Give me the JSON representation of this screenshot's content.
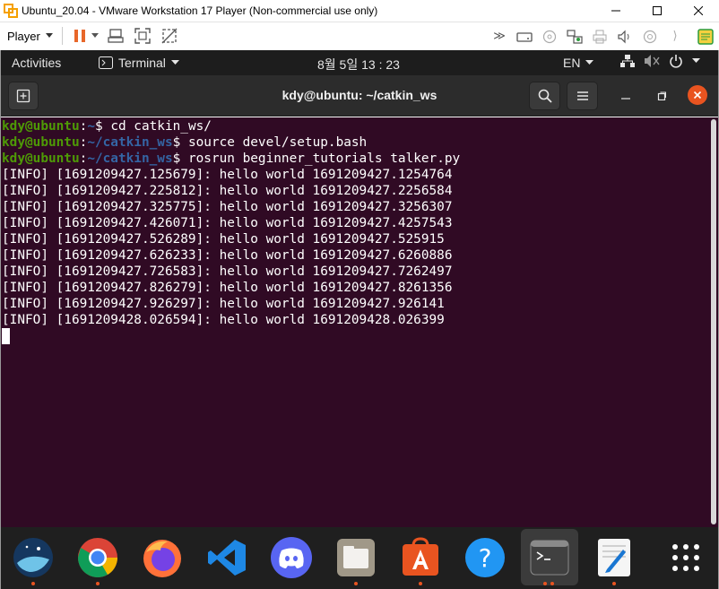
{
  "vmware": {
    "title": "Ubuntu_20.04 - VMware Workstation 17 Player (Non-commercial use only)",
    "player_label": "Player",
    "controls": {
      "minimize": "—",
      "maximize": "☐",
      "close": "✕"
    }
  },
  "top_panel": {
    "activities": "Activities",
    "app_name": "Terminal",
    "clock": "8월 5일  13 : 23",
    "input_lang": "EN"
  },
  "terminal": {
    "title": "kdy@ubuntu: ~/catkin_ws",
    "lines": [
      {
        "user": "kdy@ubuntu",
        "path": "~",
        "sep": ":",
        "prompt": "$ ",
        "cmd": "cd catkin_ws/"
      },
      {
        "user": "kdy@ubuntu",
        "path": "~/catkin_ws",
        "sep": ":",
        "prompt": "$ ",
        "cmd": "source devel/setup.bash"
      },
      {
        "user": "kdy@ubuntu",
        "path": "~/catkin_ws",
        "sep": ":",
        "prompt": "$ ",
        "cmd": "rosrun beginner_tutorials talker.py"
      }
    ],
    "output": [
      "[INFO] [1691209427.125679]: hello world 1691209427.1254764",
      "[INFO] [1691209427.225812]: hello world 1691209427.2256584",
      "[INFO] [1691209427.325775]: hello world 1691209427.3256307",
      "[INFO] [1691209427.426071]: hello world 1691209427.4257543",
      "[INFO] [1691209427.526289]: hello world 1691209427.525915",
      "[INFO] [1691209427.626233]: hello world 1691209427.6260886",
      "[INFO] [1691209427.726583]: hello world 1691209427.7262497",
      "[INFO] [1691209427.826279]: hello world 1691209427.8261356",
      "[INFO] [1691209427.926297]: hello world 1691209427.926141",
      "[INFO] [1691209428.026594]: hello world 1691209428.026399"
    ]
  },
  "dock": {
    "items": [
      {
        "name": "shotwell-icon",
        "running": true
      },
      {
        "name": "chrome-icon",
        "running": true
      },
      {
        "name": "firefox-icon",
        "running": false
      },
      {
        "name": "vscode-icon",
        "running": false
      },
      {
        "name": "discord-icon",
        "running": false
      },
      {
        "name": "files-icon",
        "running": true
      },
      {
        "name": "software-center-icon",
        "running": true
      },
      {
        "name": "help-icon",
        "running": false
      },
      {
        "name": "terminal-icon",
        "running": true
      },
      {
        "name": "text-editor-icon",
        "running": true
      },
      {
        "name": "app-grid-icon",
        "running": false
      }
    ]
  },
  "colors": {
    "terminal_bg": "#300a24",
    "prompt_user": "#4e9a06",
    "prompt_path": "#3465a4",
    "ubuntu_orange": "#e95420"
  }
}
